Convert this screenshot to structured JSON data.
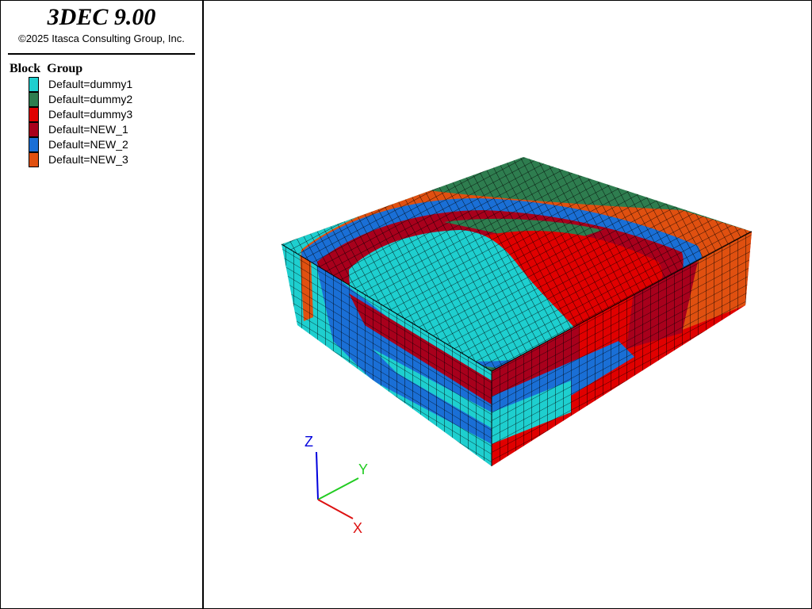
{
  "app": {
    "title": "3DEC 9.00",
    "copyright": "©2025 Itasca Consulting Group, Inc."
  },
  "legend": {
    "title": "Block  Group",
    "items": [
      {
        "label": "Default=dummy1",
        "color": "#1ecfcf"
      },
      {
        "label": "Default=dummy2",
        "color": "#2e7d4f"
      },
      {
        "label": "Default=dummy3",
        "color": "#e00000"
      },
      {
        "label": "Default=NEW_1",
        "color": "#a8001c"
      },
      {
        "label": "Default=NEW_2",
        "color": "#1a6fd6"
      },
      {
        "label": "Default=NEW_3",
        "color": "#e05010"
      }
    ]
  },
  "axes": {
    "z": {
      "label": "Z",
      "color": "#0000dd"
    },
    "y": {
      "label": "Y",
      "color": "#22cc22"
    },
    "x": {
      "label": "X",
      "color": "#dd1111"
    }
  }
}
